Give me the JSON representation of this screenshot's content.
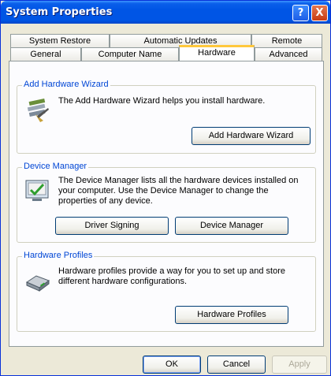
{
  "window": {
    "title": "System Properties"
  },
  "titlebar": {
    "help": "?",
    "close": "X"
  },
  "tabs_back": [
    "System Restore",
    "Automatic Updates",
    "Remote"
  ],
  "tabs_front": [
    "General",
    "Computer Name",
    "Hardware",
    "Advanced"
  ],
  "active_tab": "Hardware",
  "add_hardware": {
    "legend": "Add Hardware Wizard",
    "text": "The Add Hardware Wizard helps you install hardware.",
    "button": "Add Hardware Wizard"
  },
  "device_manager": {
    "legend": "Device Manager",
    "text": "The Device Manager lists all the hardware devices installed on your computer. Use the Device Manager to change the properties of any device.",
    "driver_signing_button": "Driver Signing",
    "device_manager_button": "Device Manager"
  },
  "hardware_profiles": {
    "legend": "Hardware Profiles",
    "text": "Hardware profiles provide a way for you to set up and store different hardware configurations.",
    "button": "Hardware Profiles"
  },
  "footer": {
    "ok": "OK",
    "cancel": "Cancel",
    "apply": "Apply"
  },
  "colors": {
    "title_blue": "#0055E5",
    "group_legend": "#0046D5",
    "tab_highlight": "#FFC83C"
  }
}
